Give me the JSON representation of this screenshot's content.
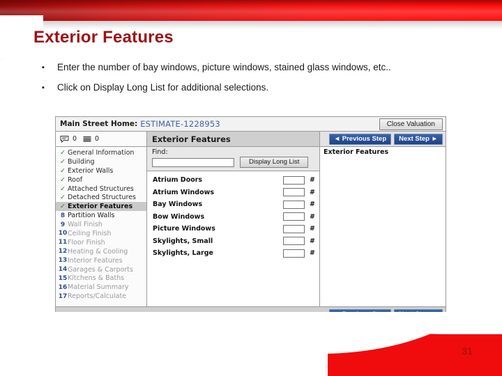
{
  "slide": {
    "title": "Exterior Features",
    "page_number": "31",
    "bullet_marker": "▪",
    "bullets": [
      "Enter the number of bay windows, picture windows, stained glass windows, etc..",
      "Click on Display Long List for additional selections."
    ],
    "accent_color": "#9e1114",
    "band_color": "#f00c0c"
  },
  "app": {
    "titlebar": {
      "property_label": "Main Street Home:",
      "estimate_id": "ESTIMATE-1228953",
      "close_button": "Close Valuation"
    },
    "toolbar": {
      "comment_count": "0",
      "notes_count": "0"
    },
    "panel_header": "Exterior Features",
    "step_nav": {
      "previous": "◄ Previous Step",
      "next": "Next Step ►"
    },
    "steps": [
      {
        "marker": "✓",
        "label": "General Information",
        "state": "done"
      },
      {
        "marker": "✓",
        "label": "Building",
        "state": "done"
      },
      {
        "marker": "✓",
        "label": "Exterior Walls",
        "state": "done"
      },
      {
        "marker": "✓",
        "label": "Roof",
        "state": "done"
      },
      {
        "marker": "✓",
        "label": "Attached Structures",
        "state": "done"
      },
      {
        "marker": "✓",
        "label": "Detached Structures",
        "state": "done"
      },
      {
        "marker": "✓",
        "label": "Exterior Features",
        "state": "active"
      },
      {
        "marker": "8",
        "label": "Partition Walls",
        "state": "next"
      },
      {
        "marker": "9",
        "label": "Wall Finish",
        "state": "pending"
      },
      {
        "marker": "10",
        "label": "Ceiling Finish",
        "state": "pending"
      },
      {
        "marker": "11",
        "label": "Floor Finish",
        "state": "pending"
      },
      {
        "marker": "12",
        "label": "Heating & Cooling",
        "state": "pending"
      },
      {
        "marker": "13",
        "label": "Interior Features",
        "state": "pending"
      },
      {
        "marker": "14",
        "label": "Garages & Carports",
        "state": "pending"
      },
      {
        "marker": "15",
        "label": "Kitchens & Baths",
        "state": "pending"
      },
      {
        "marker": "16",
        "label": "Material Summary",
        "state": "pending"
      },
      {
        "marker": "17",
        "label": "Reports/Calculate",
        "state": "pending"
      }
    ],
    "find": {
      "label": "Find:",
      "value": "",
      "placeholder": "",
      "long_list_button": "Display Long List"
    },
    "fields": [
      {
        "label": "Atrium Doors",
        "value": "",
        "unit": "#"
      },
      {
        "label": "Atrium Windows",
        "value": "",
        "unit": "#"
      },
      {
        "label": "Bay Windows",
        "value": "",
        "unit": "#"
      },
      {
        "label": "Bow Windows",
        "value": "",
        "unit": "#"
      },
      {
        "label": "Picture Windows",
        "value": "",
        "unit": "#"
      },
      {
        "label": "Skylights, Small",
        "value": "",
        "unit": "#"
      },
      {
        "label": "Skylights, Large",
        "value": "",
        "unit": "#"
      }
    ],
    "right_panel": {
      "title": "Exterior Features"
    }
  }
}
